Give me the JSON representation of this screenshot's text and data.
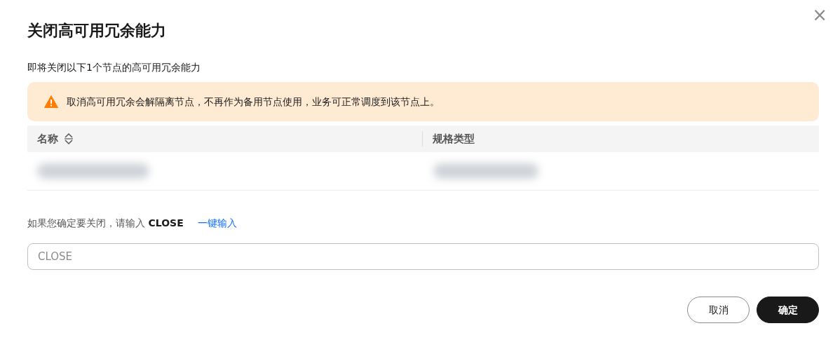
{
  "dialog": {
    "title": "关闭高可用冗余能力",
    "close_label": "×"
  },
  "intro": "即将关闭以下1个节点的高可用冗余能力",
  "alert": {
    "kind": "warning",
    "text": "取消高可用冗余会解隔离节点，不再作为备用节点使用，业务可正常调度到该节点上。"
  },
  "table": {
    "columns": [
      {
        "label": "名称",
        "sortable": true
      },
      {
        "label": "规格类型",
        "sortable": false
      }
    ],
    "rows": [
      {
        "redacted": true
      }
    ]
  },
  "confirm_prompt": {
    "text": "如果您确定要关闭，请输入 **CLOSE**",
    "link": "一键输入"
  },
  "input": {
    "placeholder": "CLOSE"
  },
  "buttons": [
    {
      "label": "取消",
      "kind": "secondary"
    },
    {
      "label": "确定",
      "kind": "primary"
    }
  ]
}
